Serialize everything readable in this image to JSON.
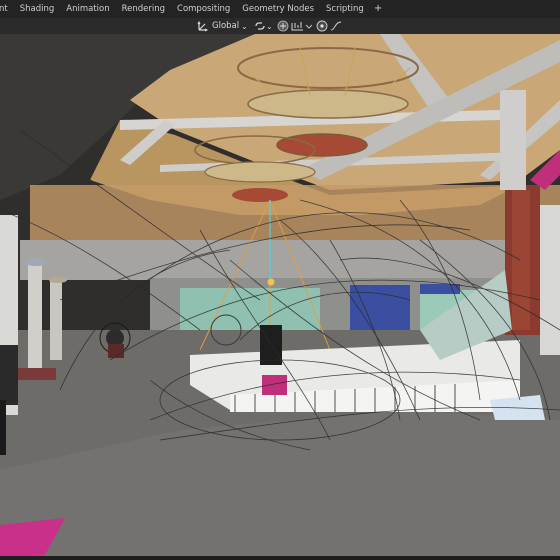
{
  "workspace_tabs": [
    {
      "label": "nt"
    },
    {
      "label": "Shading"
    },
    {
      "label": "Animation"
    },
    {
      "label": "Rendering"
    },
    {
      "label": "Compositing"
    },
    {
      "label": "Geometry Nodes"
    },
    {
      "label": "Scripting"
    }
  ],
  "add_tab_label": "+",
  "header": {
    "transform_orientation": "Global",
    "orientation_chevron": "⌄",
    "snap_chevron": "⌄"
  },
  "icons": {
    "orientation": "transform-orientation-icon",
    "snap": "snap-icon",
    "snap_target": "snap-increment-icon",
    "proportional": "proportional-edit-icon",
    "proportional_falloff": "falloff-icon"
  },
  "colors": {
    "topbar_bg": "#232323",
    "header_bg": "#2b2b2b",
    "floor": "#6e6c69",
    "ceiling": "#c9a777",
    "wall_teal": "#8fc0b0",
    "column_red": "#8a3a2e",
    "magenta": "#c0307a",
    "banner_blue": "#3b4fa0"
  }
}
